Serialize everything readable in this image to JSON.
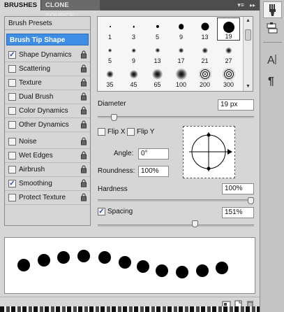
{
  "tabs": [
    {
      "label": "BRUSHES",
      "active": true
    },
    {
      "label": "CLONE SOURCE",
      "active": false
    }
  ],
  "left_panel": {
    "brush_presets": "Brush Presets",
    "brush_tip_shape": "Brush Tip Shape",
    "options": [
      {
        "label": "Shape Dynamics",
        "checked": true,
        "locked": true
      },
      {
        "label": "Scattering",
        "checked": false,
        "locked": true
      },
      {
        "label": "Texture",
        "checked": false,
        "locked": true
      },
      {
        "label": "Dual Brush",
        "checked": false,
        "locked": true
      },
      {
        "label": "Color Dynamics",
        "checked": false,
        "locked": true
      },
      {
        "label": "Other Dynamics",
        "checked": false,
        "locked": true
      },
      {
        "label": "Noise",
        "checked": false,
        "locked": true
      },
      {
        "label": "Wet Edges",
        "checked": false,
        "locked": true
      },
      {
        "label": "Airbrush",
        "checked": false,
        "locked": true
      },
      {
        "label": "Smoothing",
        "checked": true,
        "locked": true
      },
      {
        "label": "Protect Texture",
        "checked": false,
        "locked": true
      }
    ]
  },
  "preset_grid": {
    "rows": [
      [
        {
          "size": "1",
          "type": "hard"
        },
        {
          "size": "3",
          "type": "hard"
        },
        {
          "size": "5",
          "type": "hard"
        },
        {
          "size": "9",
          "type": "hard"
        },
        {
          "size": "13",
          "type": "hard"
        },
        {
          "size": "19",
          "type": "hard",
          "selected": true
        }
      ],
      [
        {
          "size": "5",
          "type": "soft"
        },
        {
          "size": "9",
          "type": "soft"
        },
        {
          "size": "13",
          "type": "soft"
        },
        {
          "size": "17",
          "type": "soft"
        },
        {
          "size": "21",
          "type": "soft"
        },
        {
          "size": "27",
          "type": "soft"
        }
      ],
      [
        {
          "size": "35",
          "type": "soft"
        },
        {
          "size": "45",
          "type": "soft"
        },
        {
          "size": "65",
          "type": "soft"
        },
        {
          "size": "100",
          "type": "soft"
        },
        {
          "size": "200",
          "type": "speckle"
        },
        {
          "size": "300",
          "type": "speckle"
        }
      ]
    ]
  },
  "diameter": {
    "label": "Diameter",
    "value": "19 px",
    "slider_fraction": 0.09
  },
  "flip": {
    "x_label": "Flip X",
    "y_label": "Flip Y",
    "x_checked": false,
    "y_checked": false
  },
  "angle": {
    "label": "Angle:",
    "value": "0°"
  },
  "roundness": {
    "label": "Roundness:",
    "value": "100%"
  },
  "hardness": {
    "label": "Hardness",
    "value": "100%",
    "slider_fraction": 1.0
  },
  "spacing": {
    "label": "Spacing",
    "value": "151%",
    "checked": true,
    "slider_fraction": 0.63
  },
  "dock_icons": [
    "brush-palette-icon",
    "clone-source-icon",
    "character-icon",
    "paragraph-icon"
  ],
  "bottom_icons": [
    "toggle-live-preview-icon",
    "new-preset-icon",
    "trash-icon"
  ],
  "colors": {
    "accent": "#3e8ee5",
    "panel_bg": "#d6d6d6",
    "tabbar": "#4d4d4d"
  }
}
